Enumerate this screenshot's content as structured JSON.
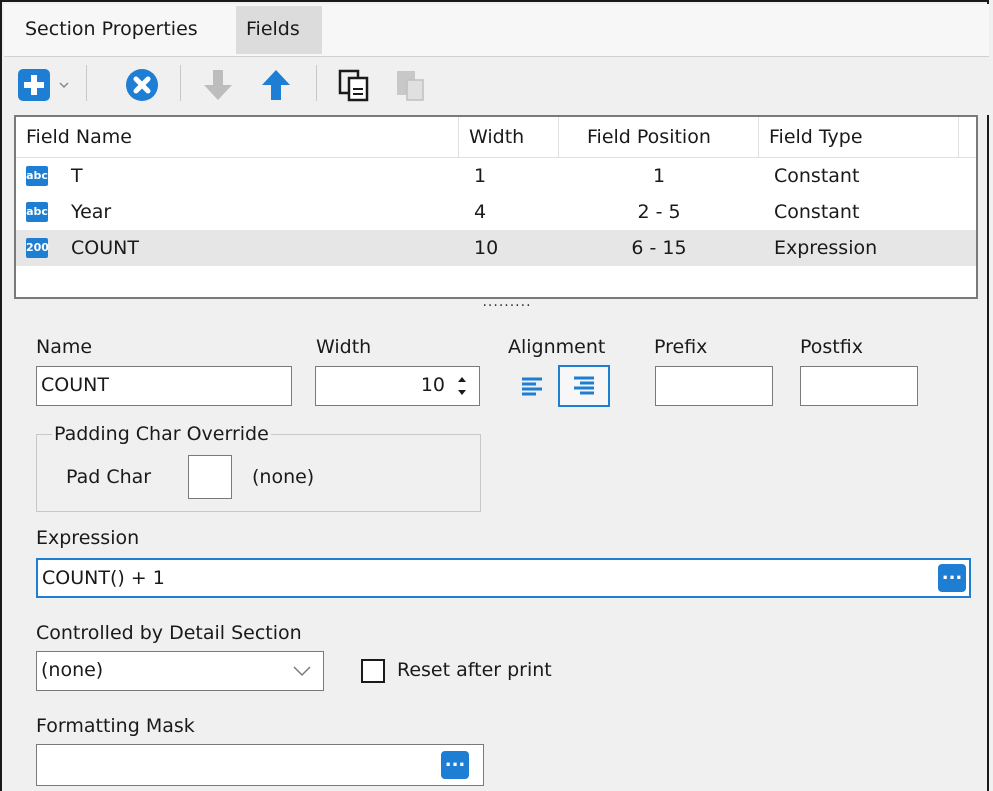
{
  "tabs": {
    "section_properties": "Section Properties",
    "fields": "Fields"
  },
  "toolbar": {
    "add": "plus-icon",
    "add_menu": "chevron-down-icon",
    "delete": "close-circle-icon",
    "move_down": "arrow-down-icon",
    "move_up": "arrow-up-icon",
    "copy": "copy-icon",
    "paste": "paste-icon",
    "accent": "#1e7ed4"
  },
  "grid": {
    "columns": [
      "Field Name",
      "Width",
      "Field Position",
      "Field Type"
    ],
    "rows": [
      {
        "icon": "abc",
        "name": "T",
        "width": "1",
        "position": "1",
        "type": "Constant"
      },
      {
        "icon": "abc",
        "name": "Year",
        "width": "4",
        "position": "2 - 5",
        "type": "Constant"
      },
      {
        "icon": "200",
        "name": "COUNT",
        "width": "10",
        "position": "6 - 15",
        "type": "Expression"
      }
    ],
    "splitter": "........."
  },
  "form": {
    "name_label": "Name",
    "name_value": "COUNT",
    "width_label": "Width",
    "width_value": "10",
    "alignment_label": "Alignment",
    "prefix_label": "Prefix",
    "prefix_value": "",
    "postfix_label": "Postfix",
    "postfix_value": "",
    "padding_group": "Padding Char Override",
    "pad_char_label": "Pad Char",
    "pad_char_value": "",
    "pad_char_none": "(none)",
    "expression_label": "Expression",
    "expression_value": "COUNT() + 1",
    "controlled_label": "Controlled by Detail Section",
    "controlled_value": "(none)",
    "reset_label": "Reset after print",
    "reset_checked": false,
    "mask_label": "Formatting Mask",
    "mask_value": "",
    "ellipsis": "..."
  }
}
